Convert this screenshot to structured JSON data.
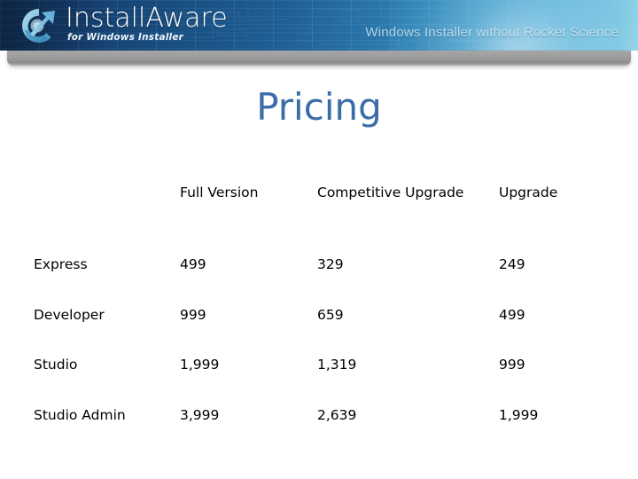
{
  "banner": {
    "logo_icon": "installaware-swirl-arrow-icon",
    "brand_first": "Install",
    "brand_second": "Aware",
    "brand_tagline": "for Windows Installer",
    "slogan": "Windows Installer without Rocket Science"
  },
  "slide": {
    "title": "Pricing"
  },
  "table": {
    "headers": [
      "",
      "Full Version",
      "Competitive Upgrade",
      "Upgrade"
    ],
    "rows": [
      {
        "tier": "Express",
        "full_version": "499",
        "competitive_upgrade": "329",
        "upgrade": "249"
      },
      {
        "tier": "Developer",
        "full_version": "999",
        "competitive_upgrade": "659",
        "upgrade": "499"
      },
      {
        "tier": "Studio",
        "full_version": "1,999",
        "competitive_upgrade": "1,319",
        "upgrade": "999"
      },
      {
        "tier": "Studio Admin",
        "full_version": "3,999",
        "competitive_upgrade": "2,639",
        "upgrade": "1,999"
      }
    ]
  },
  "colors": {
    "title_blue": "#3A6DA8",
    "banner_dark": "#133358",
    "banner_light": "#9AD6EA",
    "gray_bar": "#9d9d9d"
  }
}
